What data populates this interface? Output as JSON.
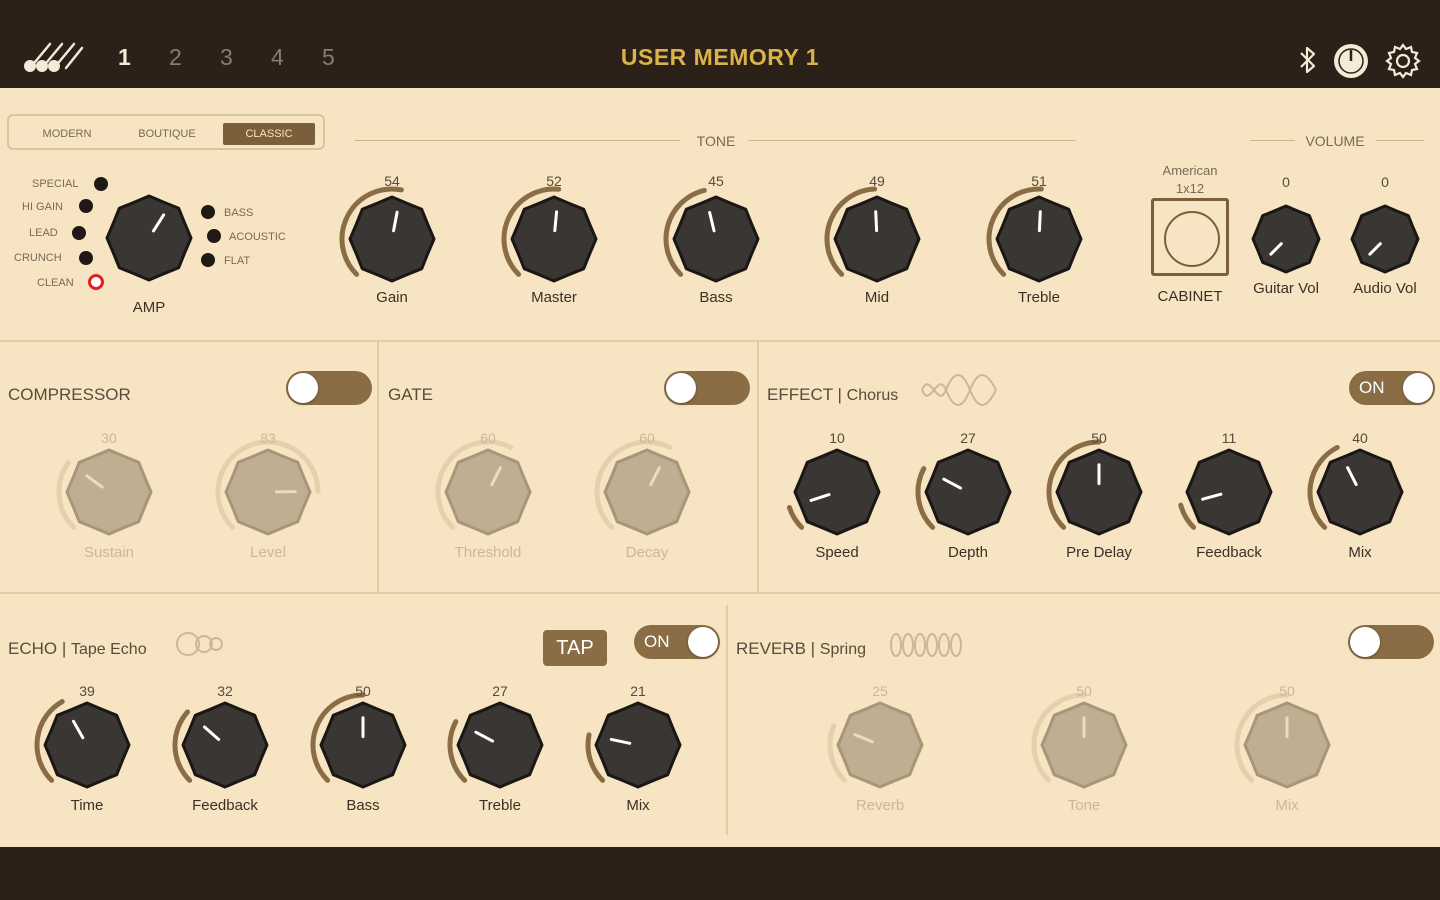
{
  "topbar": {
    "memories": [
      "1",
      "2",
      "3",
      "4",
      "5"
    ],
    "active_memory": "1",
    "title": "USER MEMORY 1",
    "icons": [
      "guitar-logo-icon",
      "bluetooth-icon",
      "tuner-icon",
      "gear-icon"
    ]
  },
  "amp_type": {
    "options": [
      "MODERN",
      "BOUTIQUE",
      "CLASSIC"
    ],
    "selected": "CLASSIC"
  },
  "amp": {
    "label": "AMP",
    "left_modes": [
      "SPECIAL",
      "HI GAIN",
      "LEAD",
      "CRUNCH",
      "CLEAN"
    ],
    "right_modes": [
      "BASS",
      "ACOUSTIC",
      "FLAT"
    ],
    "selected": "CLEAN"
  },
  "tone": {
    "label": "TONE",
    "knobs": [
      {
        "name": "Gain",
        "value": "54"
      },
      {
        "name": "Master",
        "value": "52"
      },
      {
        "name": "Bass",
        "value": "45"
      },
      {
        "name": "Mid",
        "value": "49"
      },
      {
        "name": "Treble",
        "value": "51"
      }
    ]
  },
  "cabinet": {
    "type_line1": "American",
    "type_line2": "1x12",
    "label": "CABINET"
  },
  "volume": {
    "label": "VOLUME",
    "knobs": [
      {
        "name": "Guitar Vol",
        "value": "0"
      },
      {
        "name": "Audio Vol",
        "value": "0"
      }
    ]
  },
  "compressor": {
    "title": "COMPRESSOR",
    "on": false,
    "knobs": [
      {
        "name": "Sustain",
        "value": "30"
      },
      {
        "name": "Level",
        "value": "83"
      }
    ]
  },
  "gate": {
    "title": "GATE",
    "on": false,
    "knobs": [
      {
        "name": "Threshold",
        "value": "60"
      },
      {
        "name": "Decay",
        "value": "60"
      }
    ]
  },
  "effect": {
    "title": "EFFECT | ",
    "type": "Chorus",
    "on": true,
    "on_label": "ON",
    "knobs": [
      {
        "name": "Speed",
        "value": "10"
      },
      {
        "name": "Depth",
        "value": "27"
      },
      {
        "name": "Pre Delay",
        "value": "50"
      },
      {
        "name": "Feedback",
        "value": "11"
      },
      {
        "name": "Mix",
        "value": "40"
      }
    ]
  },
  "echo": {
    "title": "ECHO | ",
    "type": "Tape Echo",
    "tap_label": "TAP",
    "on": true,
    "on_label": "ON",
    "knobs": [
      {
        "name": "Time",
        "value": "39"
      },
      {
        "name": "Feedback",
        "value": "32"
      },
      {
        "name": "Bass",
        "value": "50"
      },
      {
        "name": "Treble",
        "value": "27"
      },
      {
        "name": "Mix",
        "value": "21"
      }
    ]
  },
  "reverb": {
    "title": "REVERB | ",
    "type": "Spring",
    "on": false,
    "knobs": [
      {
        "name": "Reverb",
        "value": "25"
      },
      {
        "name": "Tone",
        "value": "50"
      },
      {
        "name": "Mix",
        "value": "50"
      }
    ]
  },
  "colors": {
    "background": "#f6e4c3",
    "bar": "#2b2118",
    "accent": "#d9b24a",
    "knob": "#3a3633",
    "arc": "#8a6d44",
    "clean_led": "#e32020"
  }
}
